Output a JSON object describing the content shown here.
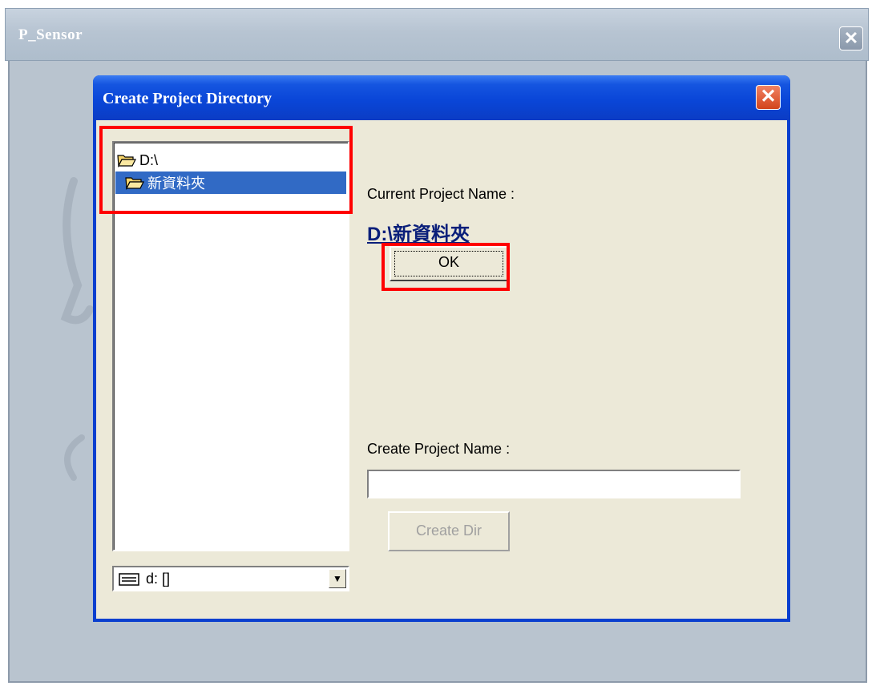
{
  "outer_window": {
    "title": "P_Sensor",
    "close_glyph": "✕"
  },
  "dialog": {
    "title": "Create Project Directory",
    "close_glyph": "✕",
    "tree": {
      "items": [
        {
          "label": "D:\\",
          "icon": "open-folder-icon",
          "selected": false
        },
        {
          "label": "新資料夾",
          "icon": "open-folder-icon",
          "selected": true
        }
      ]
    },
    "drive_combo": {
      "value": "d: []",
      "icon": "drive-icon",
      "arrow": "▼"
    },
    "current_project": {
      "label": "Current Project Name :",
      "value": "D:\\新資料夾"
    },
    "ok_label": "OK",
    "create_project": {
      "label": "Create Project Name :",
      "value": "",
      "placeholder": ""
    },
    "create_dir_label": "Create Dir"
  },
  "colors": {
    "dialog_titlebar": "#0a46d8",
    "selection": "#316ac5",
    "highlight": "#ff0000",
    "dialog_face": "#ece9d8"
  }
}
